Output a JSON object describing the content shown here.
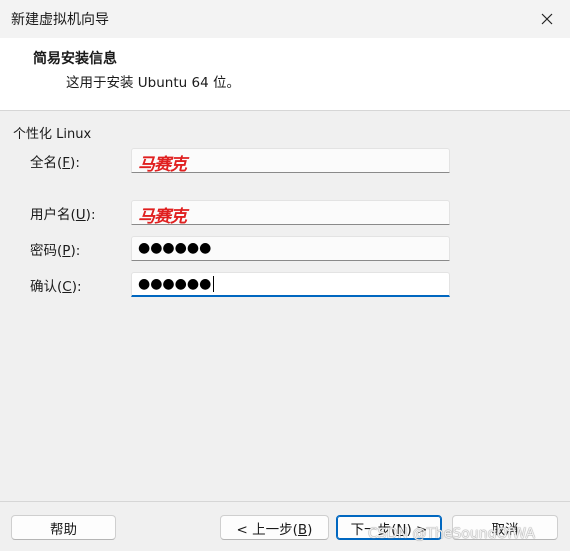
{
  "window": {
    "title": "新建虚拟机向导",
    "close_icon": "close-icon"
  },
  "header": {
    "title": "简易安装信息",
    "subtitle": "这用于安装 Ubuntu 64 位。"
  },
  "group": {
    "label": "个性化 Linux"
  },
  "fields": {
    "fullname": {
      "label_pre": "全名(",
      "label_key": "F",
      "label_post": "):",
      "value": "马赛克"
    },
    "username": {
      "label_pre": "用户名(",
      "label_key": "U",
      "label_post": "):",
      "value": "马赛克"
    },
    "password": {
      "label_pre": "密码(",
      "label_key": "P",
      "label_post": "):",
      "value": "●●●●●●"
    },
    "confirm": {
      "label_pre": "确认(",
      "label_key": "C",
      "label_post": "):",
      "value": "●●●●●●"
    }
  },
  "buttons": {
    "help": "帮助",
    "back_pre": "< 上一步(",
    "back_key": "B",
    "back_post": ")",
    "next_pre": "下一步(",
    "next_key": "N",
    "next_post": ") >",
    "cancel": "取消"
  },
  "watermark": "CSDN @TheSoundOfWA",
  "colors": {
    "accent": "#0067c0",
    "signature": "#e02020",
    "background": "#f0f0f0"
  }
}
